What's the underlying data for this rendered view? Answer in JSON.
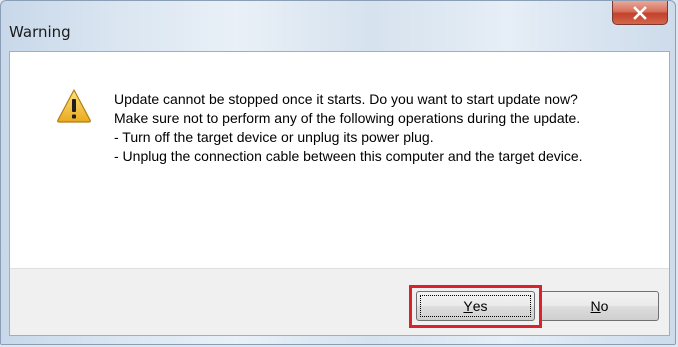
{
  "window": {
    "title": "Warning"
  },
  "titlebar": {
    "close_icon": "close-x-icon"
  },
  "dialog": {
    "icon": "warning-triangle-icon",
    "message_lines": [
      "Update cannot be stopped once it starts. Do you want to start update now?",
      "Make sure not to perform any of the following operations during the update.",
      "- Turn off the target device or unplug its power plug.",
      "- Unplug the connection cable between this computer and the target device."
    ]
  },
  "buttons": {
    "yes": {
      "accel": "Y",
      "rest": "es"
    },
    "no": {
      "accel": "N",
      "rest": "o"
    }
  },
  "colors": {
    "highlight": "#d9232a",
    "close_button": "#c2412b",
    "warning_yellow": "#f4c430"
  }
}
